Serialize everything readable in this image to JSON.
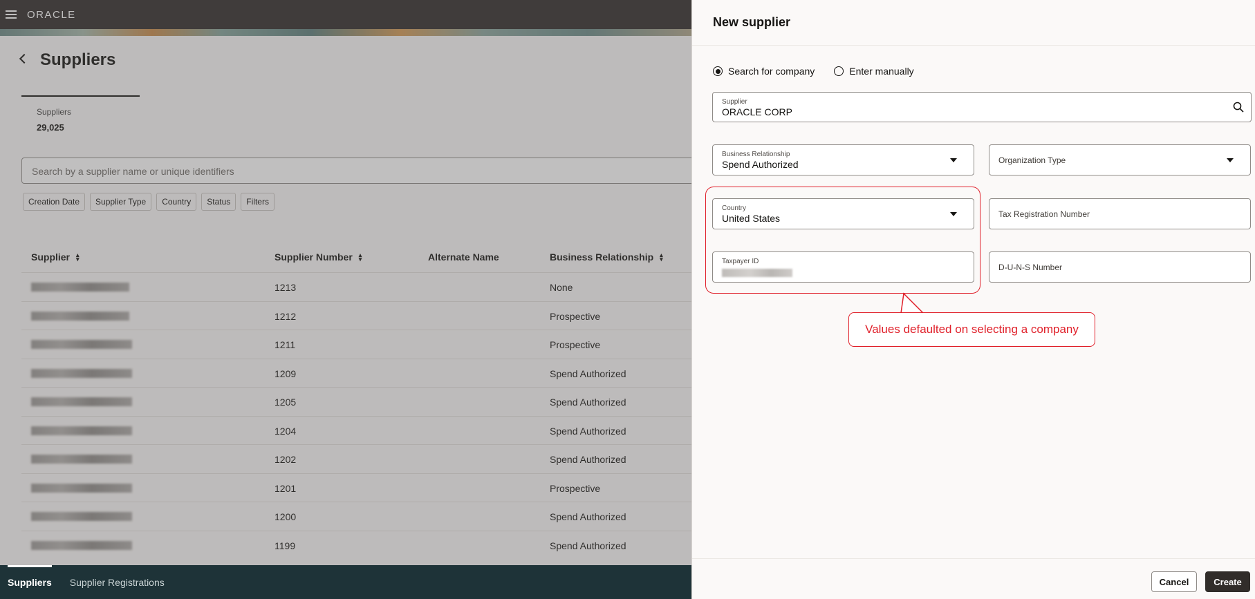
{
  "app": {
    "brand": "ORACLE"
  },
  "page": {
    "title": "Suppliers",
    "stat_label": "Suppliers",
    "stat_value": "29,025",
    "search_placeholder": "Search by a supplier name or unique identifiers",
    "filter_chips": [
      "Creation Date",
      "Supplier Type",
      "Country",
      "Status",
      "Filters"
    ],
    "table": {
      "columns": [
        "Supplier",
        "Supplier Number",
        "Alternate Name",
        "Business Relationship"
      ],
      "rows": [
        {
          "number": "1213",
          "relationship": "None"
        },
        {
          "number": "1212",
          "relationship": "Prospective"
        },
        {
          "number": "1211",
          "relationship": "Prospective"
        },
        {
          "number": "1209",
          "relationship": "Spend Authorized"
        },
        {
          "number": "1205",
          "relationship": "Spend Authorized"
        },
        {
          "number": "1204",
          "relationship": "Spend Authorized"
        },
        {
          "number": "1202",
          "relationship": "Spend Authorized"
        },
        {
          "number": "1201",
          "relationship": "Prospective"
        },
        {
          "number": "1200",
          "relationship": "Spend Authorized"
        },
        {
          "number": "1199",
          "relationship": "Spend Authorized"
        }
      ]
    },
    "bottom_tabs": [
      "Suppliers",
      "Supplier Registrations"
    ]
  },
  "drawer": {
    "title": "New supplier",
    "radio_options": [
      {
        "label": "Search for company",
        "selected": true
      },
      {
        "label": "Enter manually",
        "selected": false
      }
    ],
    "supplier_field": {
      "label": "Supplier",
      "value": "ORACLE CORP"
    },
    "business_relationship": {
      "label": "Business Relationship",
      "value": "Spend Authorized"
    },
    "organization_type": {
      "label": "Organization Type"
    },
    "country": {
      "label": "Country",
      "value": "United States"
    },
    "tax_registration": {
      "label": "Tax Registration Number"
    },
    "taxpayer_id": {
      "label": "Taxpayer ID"
    },
    "duns": {
      "label": "D-U-N-S Number"
    },
    "callout_text": "Values defaulted on selecting a company",
    "cancel_label": "Cancel",
    "create_label": "Create"
  },
  "colors": {
    "accent_red": "#e0202a",
    "header": "#312d2a",
    "bottom_bar": "#1e3338"
  }
}
